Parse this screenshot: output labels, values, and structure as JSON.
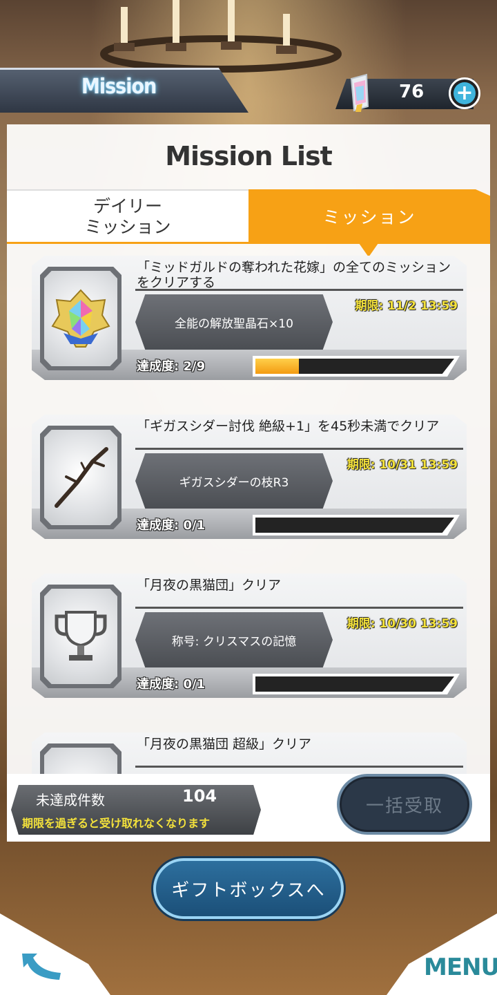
{
  "header": {
    "title": "Mission",
    "gem_count": "76",
    "plus_icon": "plus-icon"
  },
  "panel": {
    "title": "Mission List",
    "tabs": [
      {
        "label": "デイリー\nミッション",
        "active": false
      },
      {
        "label": "ミッション",
        "active": true
      }
    ]
  },
  "missions": [
    {
      "title": "「ミッドガルドの奪われた花嫁」の全てのミッションをクリアする",
      "reward": "全能の解放聖晶石×10",
      "deadline": "期限: 11/2 13:59",
      "progress_label": "達成度: 2/9",
      "progress": 0.22,
      "icon": "rainbow-crystal-icon"
    },
    {
      "title": "「ギガスシダー討伐 絶級+1」を45秒未満でクリア",
      "reward": "ギガスシダーの枝R3",
      "deadline": "期限: 10/31 13:59",
      "progress_label": "達成度: 0/1",
      "progress": 0,
      "icon": "branch-icon"
    },
    {
      "title": "「月夜の黒猫団」クリア",
      "reward": "称号: クリスマスの記憶",
      "deadline": "期限: 10/30 13:59",
      "progress_label": "達成度: 0/1",
      "progress": 0,
      "icon": "trophy-icon"
    },
    {
      "title": "「月夜の黒猫団 超級」クリア",
      "reward": "",
      "deadline": "",
      "progress_label": "",
      "progress": 0,
      "icon": "trophy-icon"
    }
  ],
  "footer": {
    "incomplete_label": "未達成件数",
    "incomplete_count": "104",
    "note": "期限を過ぎると受け取れなくなります",
    "claim_all_label": "一括受取"
  },
  "gift_box_label": "ギフトボックスへ",
  "menu_label": "MENU",
  "colors": {
    "accent": "#f7a115",
    "deadline": "#f4e23b",
    "menu": "#2a8a9a"
  }
}
